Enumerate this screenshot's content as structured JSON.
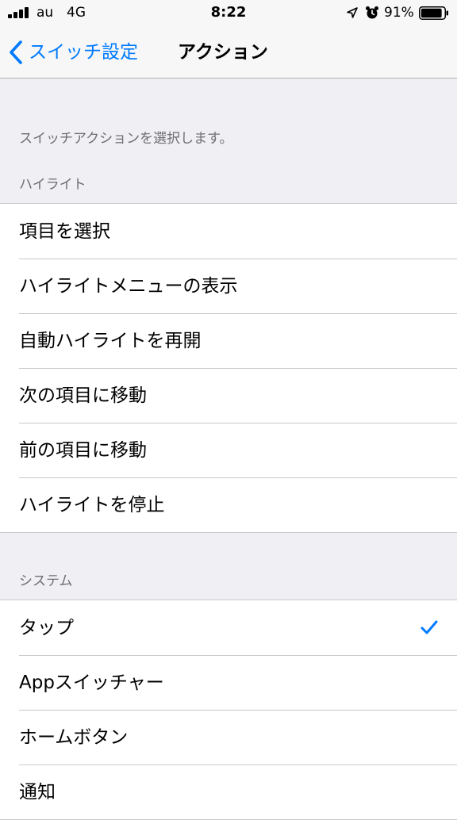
{
  "status_bar": {
    "carrier": "au",
    "network": "4G",
    "time": "8:22",
    "battery_percent": "91%",
    "battery_level": 0.91,
    "signal_bars": 4,
    "icons": [
      "signal-icon",
      "location-arrow-icon",
      "alarm-clock-icon",
      "battery-icon"
    ]
  },
  "nav": {
    "back_label": "スイッチ設定",
    "title": "アクション"
  },
  "description": "スイッチアクションを選択します。",
  "sections": {
    "highlight": {
      "header": "ハイライト",
      "items": [
        {
          "label": "項目を選択"
        },
        {
          "label": "ハイライトメニューの表示"
        },
        {
          "label": "自動ハイライトを再開"
        },
        {
          "label": "次の項目に移動"
        },
        {
          "label": "前の項目に移動"
        },
        {
          "label": "ハイライトを停止"
        }
      ]
    },
    "system": {
      "header": "システム",
      "items": [
        {
          "label": "タップ",
          "selected": true
        },
        {
          "label": "Appスイッチャー"
        },
        {
          "label": "ホームボタン"
        },
        {
          "label": "通知"
        }
      ]
    }
  },
  "colors": {
    "accent": "#007aff",
    "background": "#efeff4",
    "secondary_text": "#6d6d72",
    "separator": "#c8c7cc"
  }
}
